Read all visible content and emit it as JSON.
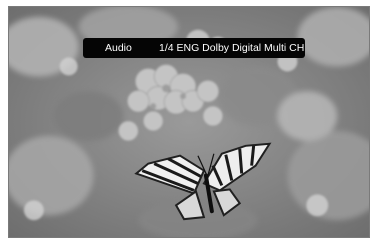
{
  "osd": {
    "label": "Audio",
    "value": "1/4 ENG Dolby Digital Multi CH"
  },
  "background": {
    "subject": "butterfly-on-flowers-photo",
    "tone": "grayscale"
  }
}
